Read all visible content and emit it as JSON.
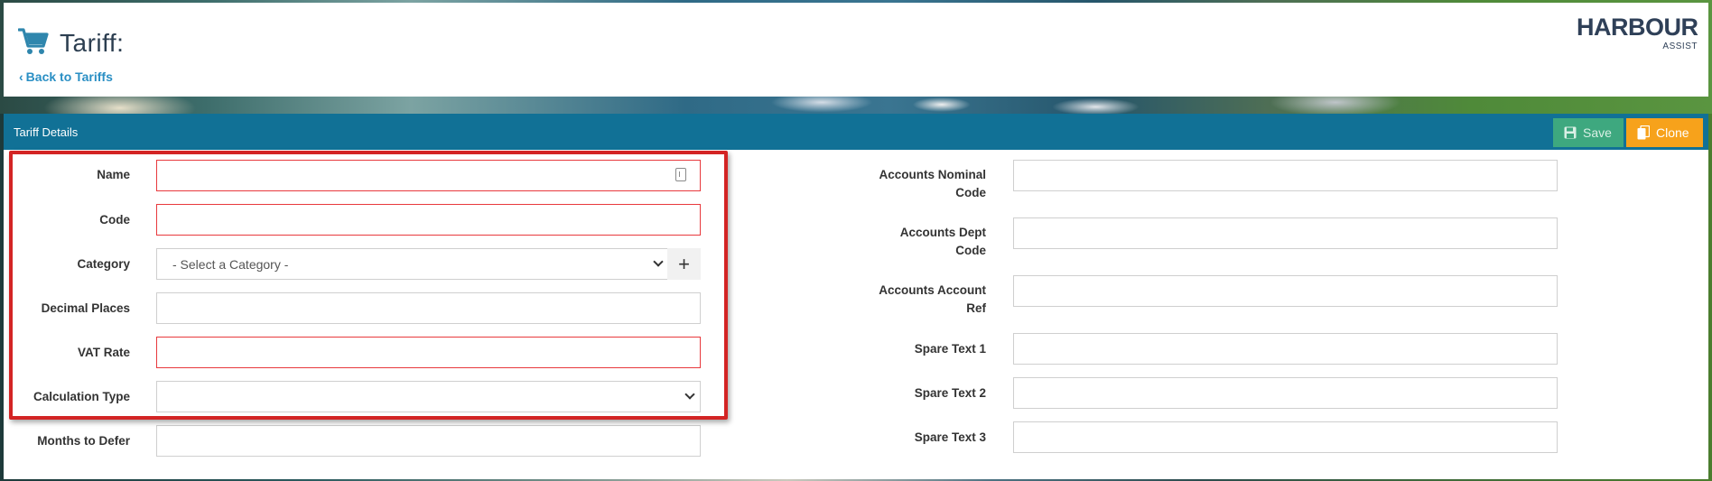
{
  "header": {
    "title": "Tariff:",
    "back_link": "Back to Tariffs",
    "logo_main": "HARBOUR",
    "logo_sub": "ASSIST"
  },
  "panel": {
    "title": "Tariff Details",
    "save_label": "Save",
    "clone_label": "Clone"
  },
  "left_fields": {
    "name": {
      "label": "Name",
      "value": ""
    },
    "code": {
      "label": "Code",
      "value": ""
    },
    "category": {
      "label": "Category",
      "selected": "- Select a Category -",
      "add": "+"
    },
    "decimal_places": {
      "label": "Decimal Places",
      "value": ""
    },
    "vat_rate": {
      "label": "VAT Rate",
      "value": ""
    },
    "calculation_type": {
      "label": "Calculation Type",
      "selected": ""
    },
    "months_to_defer": {
      "label": "Months to Defer",
      "value": ""
    }
  },
  "right_fields": {
    "accounts_nominal_code": {
      "label_1": "Accounts Nominal",
      "label_2": "Code",
      "value": ""
    },
    "accounts_dept_code": {
      "label_1": "Accounts Dept",
      "label_2": "Code",
      "value": ""
    },
    "accounts_account_ref": {
      "label_1": "Accounts Account",
      "label_2": "Ref",
      "value": ""
    },
    "spare_text_1": {
      "label": "Spare Text 1",
      "value": ""
    },
    "spare_text_2": {
      "label": "Spare Text 2",
      "value": ""
    },
    "spare_text_3": {
      "label": "Spare Text 3",
      "value": ""
    }
  },
  "colors": {
    "panel_header": "#117196",
    "save_button": "#3ea87f",
    "clone_button": "#f7a21b",
    "required_border": "#e8393d",
    "highlight": "#d32424",
    "link": "#2a8fc4"
  },
  "icons": [
    "cart-icon",
    "back-chevron-icon",
    "save-icon",
    "clone-icon",
    "password-manager-icon",
    "chevron-down-icon",
    "plus-icon"
  ]
}
